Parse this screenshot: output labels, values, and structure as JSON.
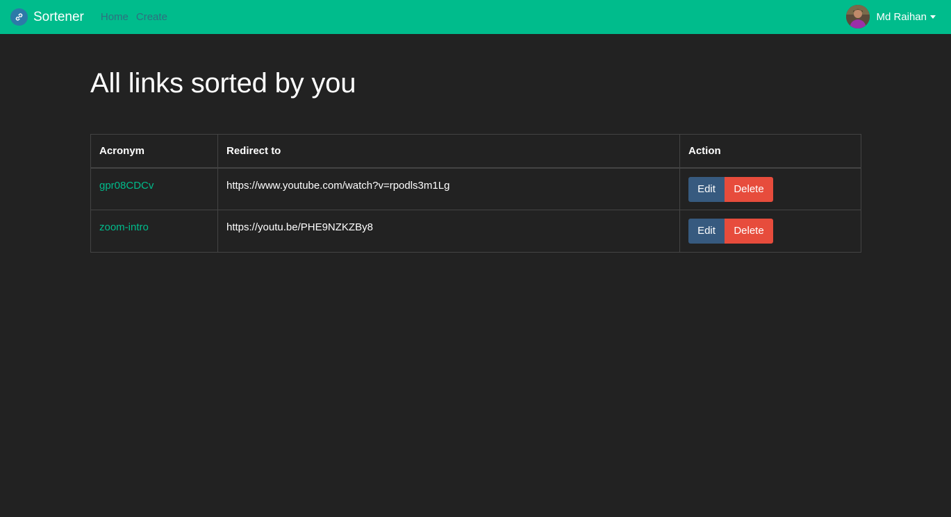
{
  "navbar": {
    "brand": "Sortener",
    "brand_icon": "link-icon",
    "links": [
      {
        "label": "Home"
      },
      {
        "label": "Create"
      }
    ],
    "user": {
      "name": "Md Raihan",
      "avatar": "user-avatar"
    },
    "colors": {
      "bar": "#00bc8c",
      "link": "#2f6f80"
    }
  },
  "main": {
    "title": "All links sorted by you",
    "table": {
      "headers": [
        "Acronym",
        "Redirect to",
        "Action"
      ],
      "rows": [
        {
          "acronym": "gpr08CDCv",
          "redirect": "https://www.youtube.com/watch?v=rpodls3m1Lg",
          "edit_label": "Edit",
          "delete_label": "Delete"
        },
        {
          "acronym": "zoom-intro",
          "redirect": "https://youtu.be/PHE9NZKZBy8",
          "edit_label": "Edit",
          "delete_label": "Delete"
        }
      ]
    },
    "colors": {
      "background": "#222222",
      "accent": "#00bc8c",
      "edit": "#375a7f",
      "delete": "#e74c3c"
    }
  }
}
